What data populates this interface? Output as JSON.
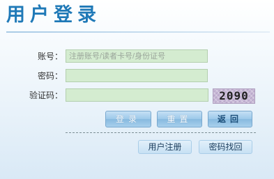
{
  "header": {
    "title": "用户登录"
  },
  "form": {
    "account_label": "账号：",
    "account_placeholder": "注册账号/读者卡号/身份证号",
    "password_label": "密码：",
    "captcha_label": "验证码：",
    "captcha_code": "2090"
  },
  "buttons": {
    "login": "登录",
    "reset": "重置",
    "back": "返回"
  },
  "links": {
    "register": "用户注册",
    "recover_password": "密码找回"
  }
}
